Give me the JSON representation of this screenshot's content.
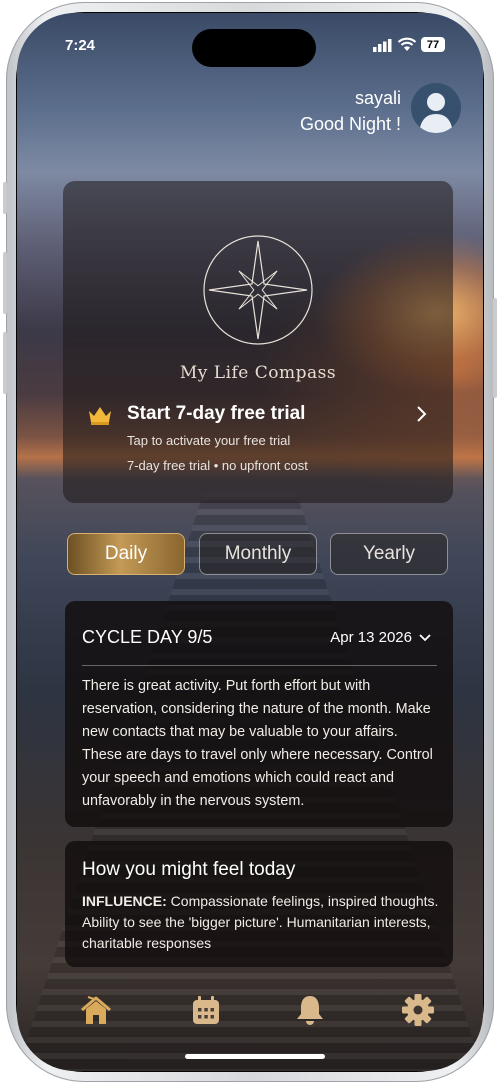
{
  "status_bar": {
    "time": "7:24",
    "battery": "77"
  },
  "header": {
    "username": "sayali",
    "greeting": "Good Night !"
  },
  "promo_card": {
    "logo_text": "My Life Compass",
    "trial_title": "Start 7-day free trial",
    "trial_subtitle": "Tap to activate your free trial",
    "trial_note": "7-day free trial • no upfront cost"
  },
  "tabs": [
    {
      "label": "Daily",
      "active": true
    },
    {
      "label": "Monthly",
      "active": false
    },
    {
      "label": "Yearly",
      "active": false
    }
  ],
  "cycle_card": {
    "title": "CYCLE DAY 9/5",
    "date": "Apr 13 2026",
    "body": "There is great activity. Put forth effort but with reservation, considering the nature of the month. Make new contacts that may be valuable to your affairs. These are days to travel only where necessary. Control your speech and emotions which could react and unfavorably in the nervous system."
  },
  "feel_card": {
    "title": "How you might feel today",
    "influence_label": "INFLUENCE:",
    "influence_text": " Compassionate feelings, inspired thoughts. Ability to see the 'bigger picture'. Humanitarian interests, charitable responses"
  },
  "bottom_nav": [
    {
      "icon": "home-icon",
      "active": true
    },
    {
      "icon": "calendar-icon",
      "active": false
    },
    {
      "icon": "bell-icon",
      "active": false
    },
    {
      "icon": "gear-icon",
      "active": false
    }
  ],
  "colors": {
    "accent_gold": "#c49a56",
    "nav_icon": "#d9b98c"
  }
}
